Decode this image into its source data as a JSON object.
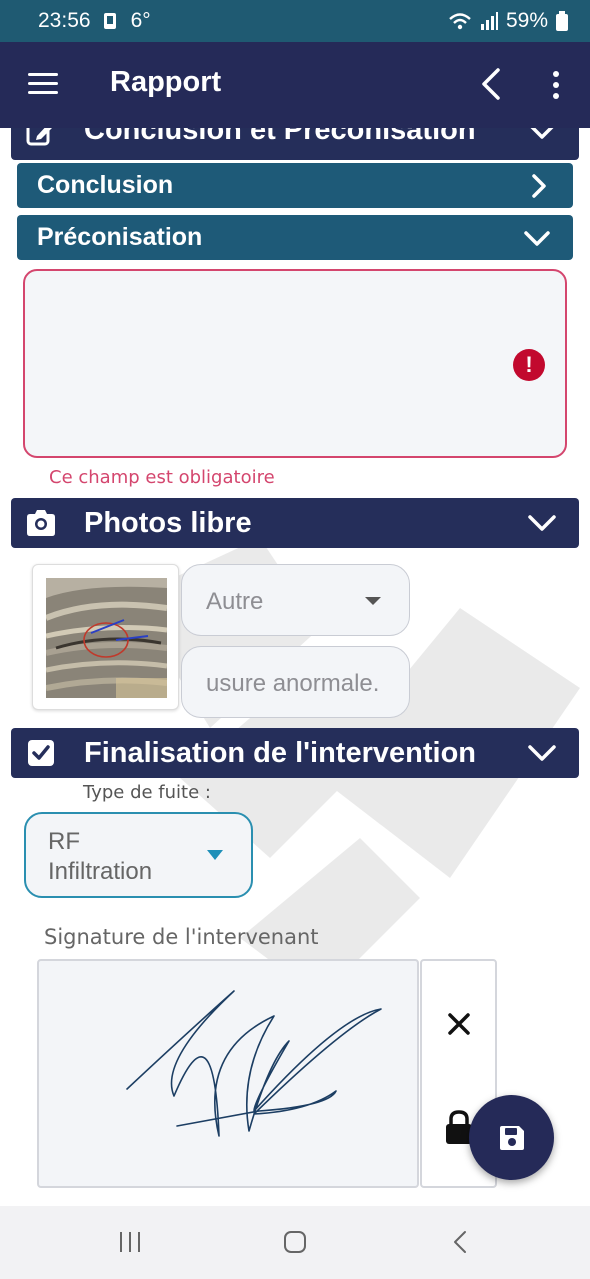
{
  "status_bar": {
    "time": "23:56",
    "temperature": "6°",
    "battery": "59%"
  },
  "app_bar": {
    "title": "Rapport",
    "icons": [
      "menu-icon",
      "back-chevron-icon",
      "more-vert-icon"
    ]
  },
  "sections": {
    "conclusion_preconisation": {
      "label": "Conclusion et Préconisation",
      "icon": "edit-icon"
    },
    "conclusion": {
      "label": "Conclusion"
    },
    "preconisation": {
      "label": "Préconisation",
      "value": "",
      "error": "Ce champ est obligatoire"
    },
    "photos_libre": {
      "label": "Photos libre",
      "icon": "camera-icon",
      "category": "Autre",
      "description": "usure anormale."
    },
    "finalisation": {
      "label": "Finalisation de l'intervention",
      "icon": "checkbox-icon",
      "type_label": "Type de fuite :",
      "type_value_line1": "RF",
      "type_value_line2": "Infiltration",
      "signature_label": "Signature de l'intervenant"
    }
  },
  "colors": {
    "status_bar": "#1f5a72",
    "app_bar": "#252a58",
    "section_header": "#252e5a",
    "sub_header": "#1e5a78",
    "error": "#d4466e",
    "fab": "#252a58"
  },
  "nav_bar": {
    "icons": [
      "recents-icon",
      "home-icon",
      "back-icon"
    ]
  }
}
